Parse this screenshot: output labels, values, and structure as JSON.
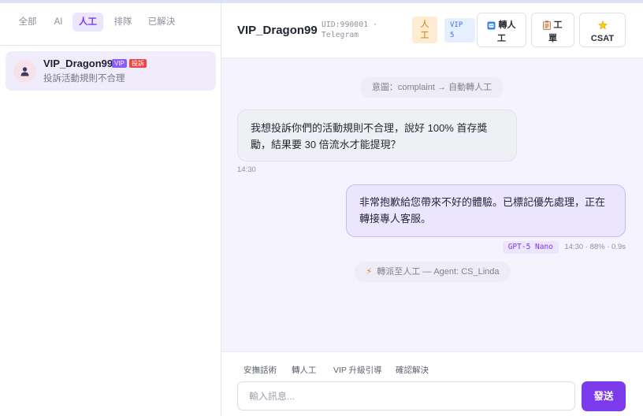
{
  "filters": {
    "tabs": [
      {
        "label": "全部",
        "active": false
      },
      {
        "label": "AI",
        "active": false
      },
      {
        "label": "人工",
        "active": true
      },
      {
        "label": "排隊",
        "active": false
      },
      {
        "label": "已解決",
        "active": false
      }
    ]
  },
  "conversations": [
    {
      "name": "VIP_Dragon99",
      "badge_vip": "VIP",
      "badge_tag": "投訴",
      "preview": "投訴活動規則不合理",
      "selected": true,
      "avatar_icon": "user-icon"
    }
  ],
  "header": {
    "title": "VIP_Dragon99",
    "uid_line1": "UID:990001 ·",
    "uid_line2": "Telegram",
    "status_pill_line1": "人",
    "status_pill_line2": "工",
    "vip_pill_line1": "VIP",
    "vip_pill_line2": "5",
    "buttons": {
      "transfer_line1": "轉人",
      "transfer_line2": "工",
      "transfer_icon": "robot-icon",
      "ticket_line1": "工",
      "ticket_line2": "單",
      "ticket_icon": "clipboard-icon",
      "csat_label": "CSAT",
      "csat_icon": "star-icon"
    }
  },
  "chat": {
    "system_intent": "意圖：complaint → 自動轉人工",
    "incoming": {
      "text": "我想投訴你們的活動規則不合理，說好 100% 首存獎勵，結果要 30 倍流水才能提現？",
      "time": "14:30"
    },
    "outgoing": {
      "text": "非常抱歉給您帶來不好的體驗。已標記優先處理，正在轉接專人客服。",
      "model": "GPT-5 Nano",
      "meta": "14:30 · 88% · 0.9s"
    },
    "system_assign": "轉派至人工 — Agent: CS_Linda",
    "system_assign_icon": "lightning-icon"
  },
  "composer": {
    "quick_replies": [
      "安撫話術",
      "轉人工",
      "VIP 升級引導",
      "確認解決"
    ],
    "placeholder": "輸入訊息...",
    "send_label": "發送"
  },
  "colors": {
    "accent": "#7c3aed",
    "accent_soft": "#ece5fe",
    "warning": "#d97706",
    "danger": "#ef4444",
    "info": "#3b74e8"
  }
}
